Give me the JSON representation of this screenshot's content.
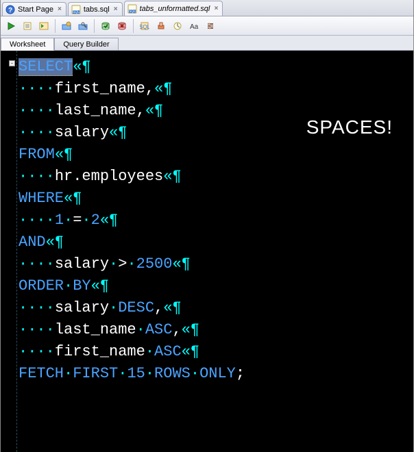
{
  "tabs": {
    "start": "Start Page",
    "t1": "tabs.sql",
    "t2": "tabs_unformatted.sql"
  },
  "subtabs": {
    "worksheet": "Worksheet",
    "querybuilder": "Query Builder"
  },
  "annotation": "SPACES!",
  "fold": "-",
  "markers": {
    "dot": "·",
    "eol": "«",
    "para": "¶"
  },
  "sql": {
    "l1_kw": "SELECT",
    "l2_txt": "first_name,",
    "l3_txt": "last_name,",
    "l4_txt": "salary",
    "l5_kw": "FROM",
    "l6_txt": "hr.employees",
    "l7_kw": "WHERE",
    "l8_a": "1",
    "l8_b": "=",
    "l8_c": "2",
    "l9_kw": "AND",
    "l10_a": "salary",
    "l10_b": ">",
    "l10_c": "2500",
    "l11_kw": "ORDER",
    "l11_kw2": "BY",
    "l12_a": "salary",
    "l12_b": "DESC",
    "l13_a": "last_name",
    "l13_b": "ASC",
    "l14_a": "first_name",
    "l14_b": "ASC",
    "l15_a": "FETCH",
    "l15_b": "FIRST",
    "l15_c": "15",
    "l15_d": "ROWS",
    "l15_e": "ONLY",
    "l15_f": ";"
  }
}
